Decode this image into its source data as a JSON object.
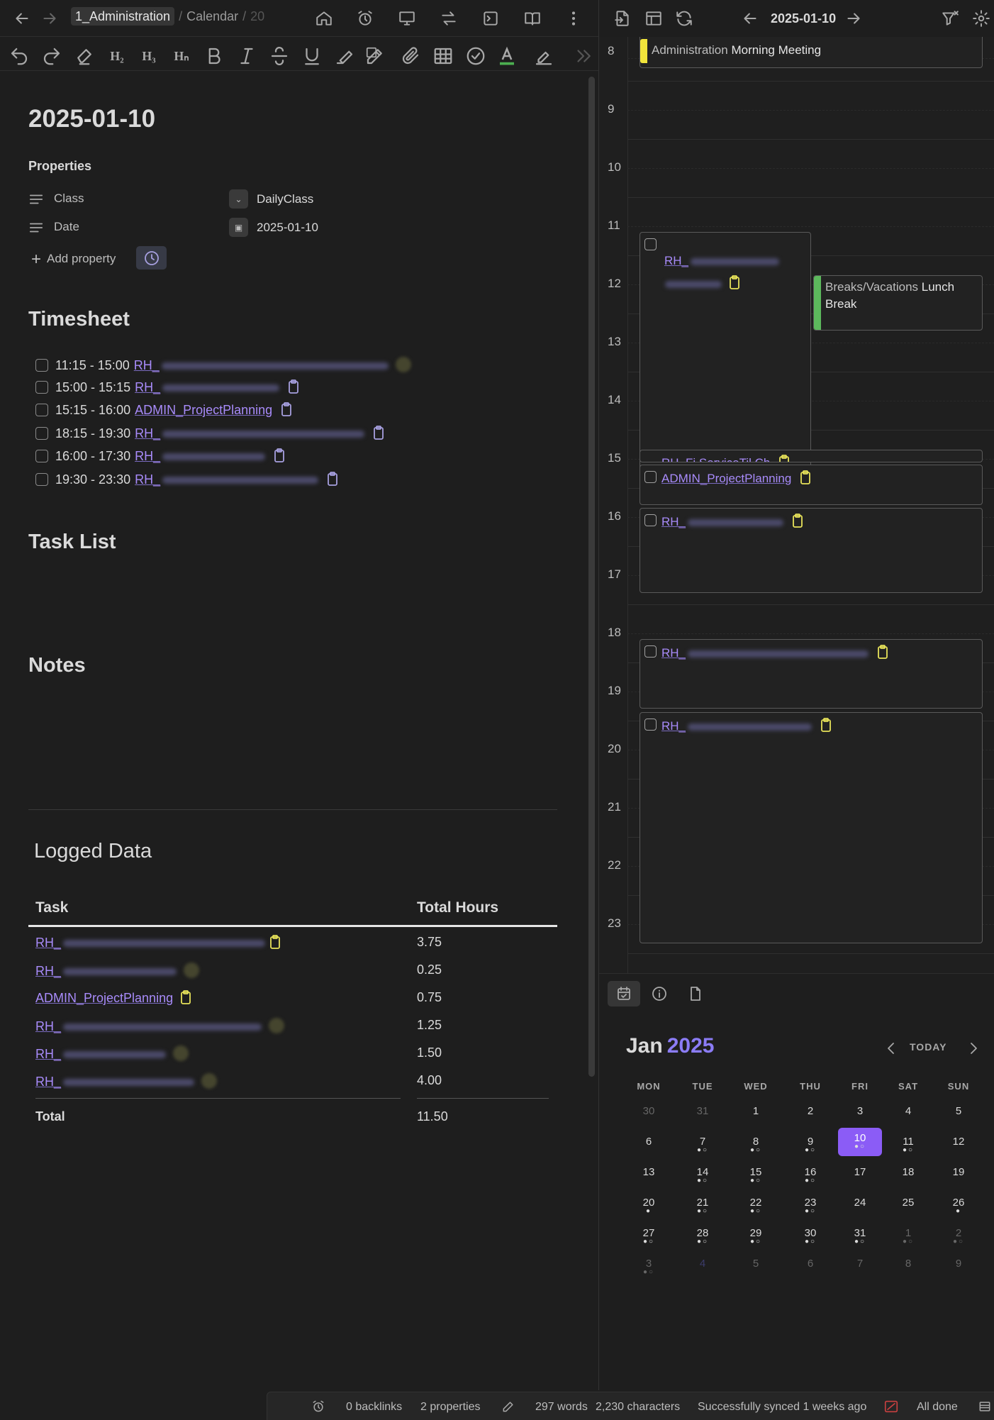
{
  "nav": {
    "crumb1": "1_Administration",
    "crumb2": "Calendar",
    "crumb3": "20"
  },
  "page": {
    "title": "2025-01-10"
  },
  "properties": {
    "heading": "Properties",
    "items": [
      {
        "key": "Class",
        "value": "DailyClass"
      },
      {
        "key": "Date",
        "value": "2025-01-10"
      }
    ],
    "add_label": "Add property"
  },
  "timesheet": {
    "heading": "Timesheet",
    "rows": [
      {
        "time": "11:15 - 15:00",
        "task": "RH_"
      },
      {
        "time": "15:00 - 15:15",
        "task": "RH_"
      },
      {
        "time": "15:15 - 16:00",
        "task": "ADMIN_ProjectPlanning"
      },
      {
        "time": "18:15 - 19:30",
        "task": "RH_"
      },
      {
        "time": "16:00 - 17:30",
        "task": "RH_"
      },
      {
        "time": "19:30 - 23:30",
        "task": "RH_"
      }
    ]
  },
  "task_list": {
    "heading": "Task List"
  },
  "notes": {
    "heading": "Notes"
  },
  "logged": {
    "heading": "Logged Data",
    "col_task": "Task",
    "col_hours": "Total Hours",
    "rows": [
      {
        "task": "RH_",
        "hours": "3.75"
      },
      {
        "task": "RH_",
        "hours": "0.25"
      },
      {
        "task": "ADMIN_ProjectPlanning",
        "hours": "0.75"
      },
      {
        "task": "RH_",
        "hours": "1.25"
      },
      {
        "task": "RH_",
        "hours": "1.50"
      },
      {
        "task": "RH_",
        "hours": "4.00"
      }
    ],
    "total_label": "Total",
    "total_value": "11.50"
  },
  "calendar": {
    "date": "2025-01-10",
    "hours": [
      "8",
      "9",
      "10",
      "11",
      "12",
      "13",
      "14",
      "15",
      "16",
      "17",
      "18",
      "19",
      "20",
      "21",
      "22",
      "23"
    ],
    "events": {
      "morning_cat": "Administration",
      "morning_title": "Morning Meeting",
      "ev1": "RH_",
      "lunch_cat": "Breaks/Vacations",
      "lunch_title": "Lunch",
      "lunch_title2": "Break",
      "ev2": "RH_Fi ServiceTil Ch",
      "ev3": "ADMIN_ProjectPlanning",
      "ev4": "RH_",
      "ev5": "RH_",
      "ev6": "RH_"
    }
  },
  "minical": {
    "month": "Jan",
    "year": "2025",
    "today": "TODAY",
    "dow": [
      "MON",
      "TUE",
      "WED",
      "THU",
      "FRI",
      "SAT",
      "SUN"
    ]
  },
  "status": {
    "backlinks": "0 backlinks",
    "properties": "2 properties",
    "words": "297 words",
    "chars": "2,230 characters",
    "sync": "Successfully synced 1 weeks ago",
    "done": "All done"
  },
  "colors": {
    "accent": "#8b5cf6",
    "link": "#a88bfa",
    "event_yellow": "#f1e43b",
    "event_green": "#5cb85c"
  }
}
